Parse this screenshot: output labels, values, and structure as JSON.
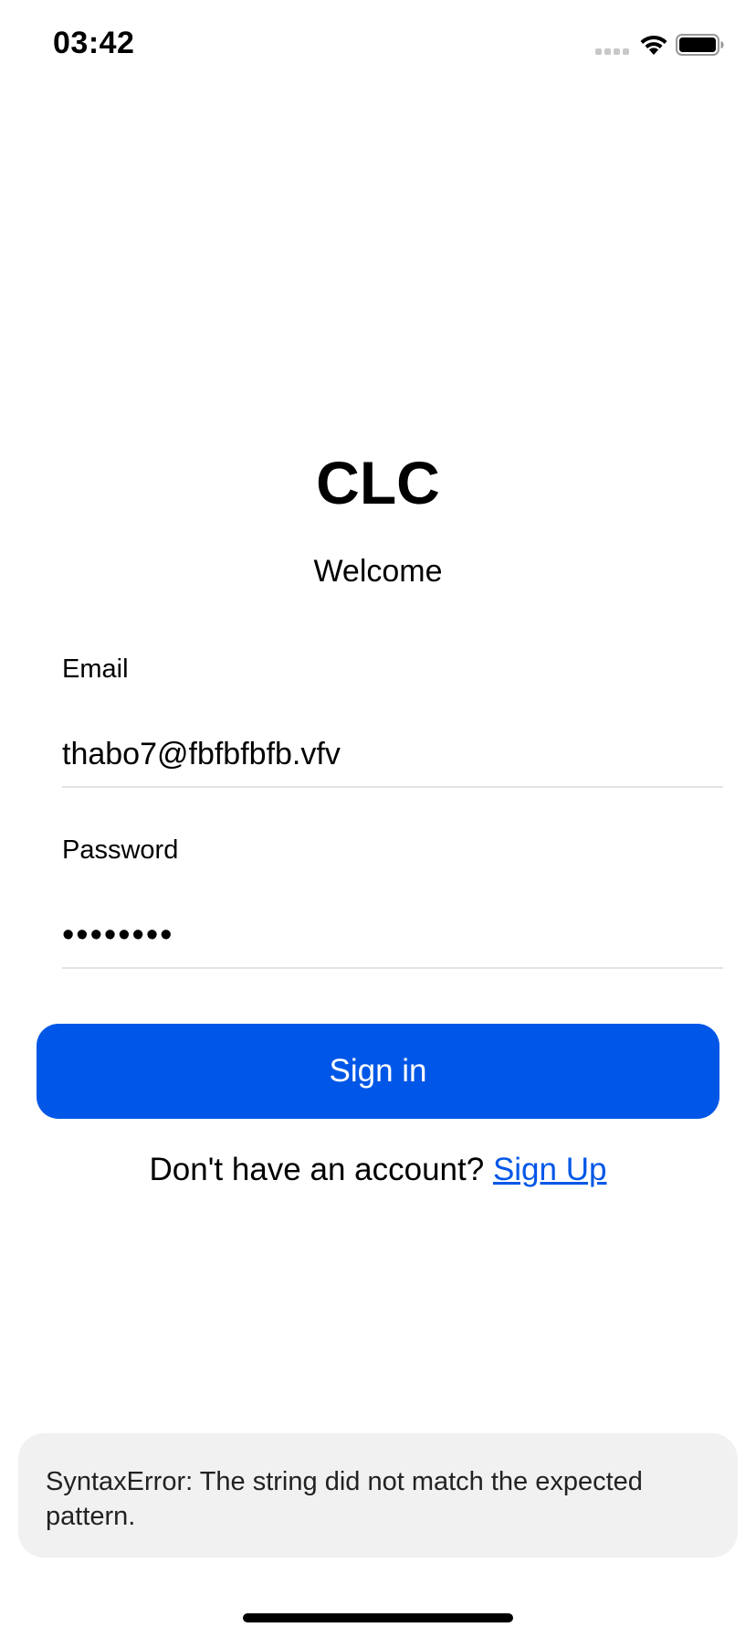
{
  "status_bar": {
    "time": "03:42",
    "icons": [
      "signal-icon",
      "wifi-icon",
      "battery-icon"
    ]
  },
  "app": {
    "title": "CLC",
    "subtitle": "Welcome"
  },
  "form": {
    "email": {
      "label": "Email",
      "value": "thabo7@fbfbfbfb.vfv"
    },
    "password": {
      "label": "Password",
      "value": "••••••••"
    },
    "submit_label": "Sign in"
  },
  "signup": {
    "prompt": "Don't have an account?",
    "link_label": "Sign Up"
  },
  "error": {
    "message": "SyntaxError: The string did not match the expected pattern."
  },
  "colors": {
    "accent": "#0057e7",
    "toast_background": "#f1f1f1"
  }
}
